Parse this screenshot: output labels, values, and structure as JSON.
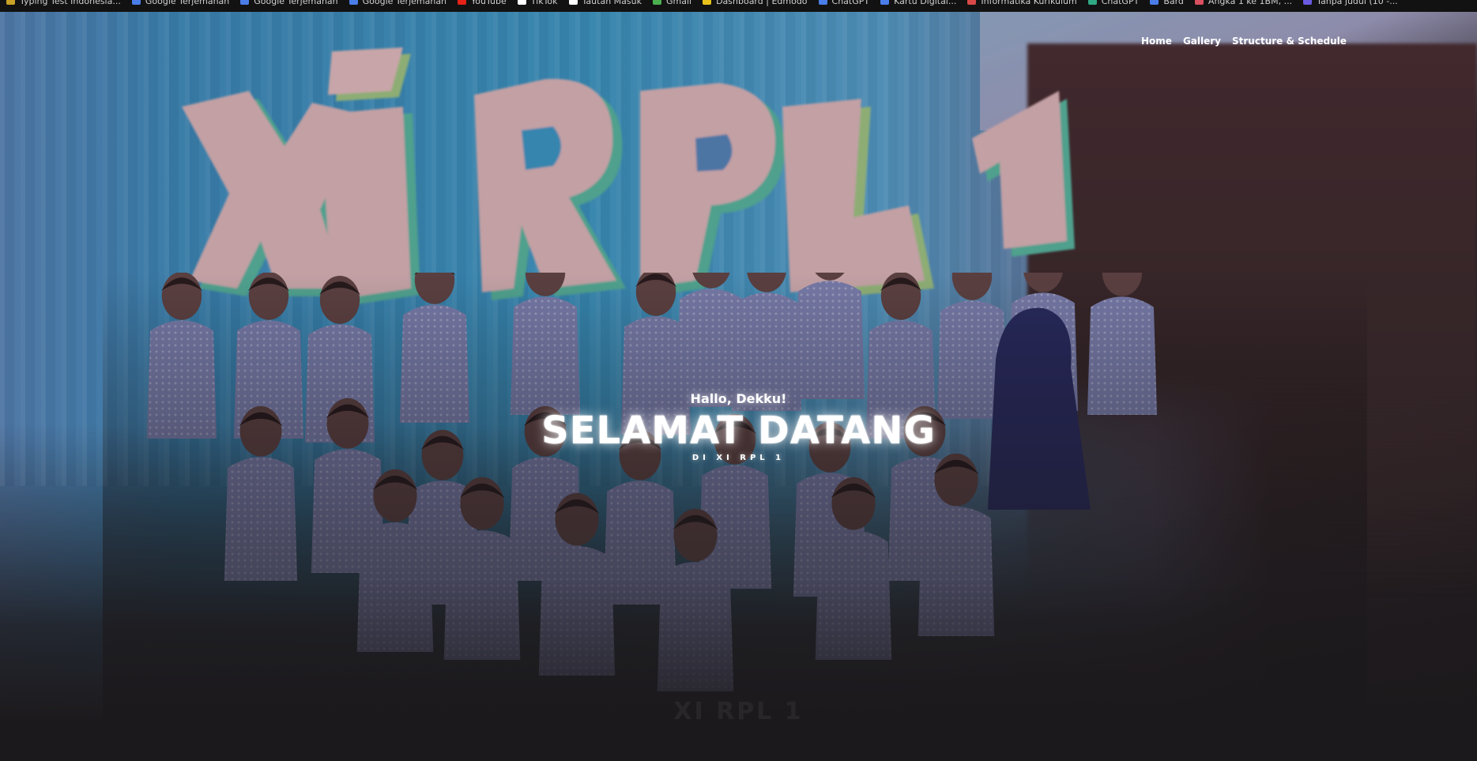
{
  "bookmarks": [
    {
      "label": "Typing Test Indonesia...",
      "icon": "keyboard-icon",
      "color": "#c9a227"
    },
    {
      "label": "Google Terjemahan",
      "icon": "translate-icon",
      "color": "#4a7de8"
    },
    {
      "label": "Google Terjemahan",
      "icon": "translate-icon",
      "color": "#4a7de8"
    },
    {
      "label": "Google Terjemahan",
      "icon": "translate-icon",
      "color": "#4a7de8"
    },
    {
      "label": "YouTube",
      "icon": "youtube-icon",
      "color": "#e62117"
    },
    {
      "label": "TikTok",
      "icon": "tiktok-icon",
      "color": "#ffffff"
    },
    {
      "label": "Tautan Masuk",
      "icon": "page-icon",
      "color": "#ffffff"
    },
    {
      "label": "Gmail",
      "icon": "gmail-icon",
      "color": "#4caf50"
    },
    {
      "label": "Dashboard | Edmodo",
      "icon": "dashboard-icon",
      "color": "#e8c21a"
    },
    {
      "label": "ChatGPT",
      "icon": "chat-icon",
      "color": "#4a7de8"
    },
    {
      "label": "Kartu Digital...",
      "icon": "card-icon",
      "color": "#4a7de8"
    },
    {
      "label": "Informatika Kurikulum",
      "icon": "book-icon",
      "color": "#d94848"
    },
    {
      "label": "ChatGPT",
      "icon": "chatgpt-icon",
      "color": "#2fa883"
    },
    {
      "label": "Bard",
      "icon": "bard-icon",
      "color": "#4a7de8"
    },
    {
      "label": "Angka 1 ke 1BM, ...",
      "icon": "bookmark-icon",
      "color": "#d95060"
    },
    {
      "label": "Tanpa judul (10 -...",
      "icon": "doc-icon",
      "color": "#6a5ae0"
    }
  ],
  "nav": {
    "home": "Home",
    "gallery": "Gallery",
    "structure": "Structure & Schedule"
  },
  "hero": {
    "greeting": "Hallo, Dekku!",
    "headline": "SELAMAT DATANG",
    "subtitle": "DI XI RPL 1",
    "graffiti_text": "XI RPL 1",
    "ghost_text": "XI RPL 1"
  },
  "colors": {
    "nav_text": "#ffffff",
    "bookmarks_bg": "#121212",
    "page_bottom": "#1e1c1e",
    "graffiti_fill": "#e8c0c4",
    "graffiti_shadow": "#5bc0a8"
  }
}
